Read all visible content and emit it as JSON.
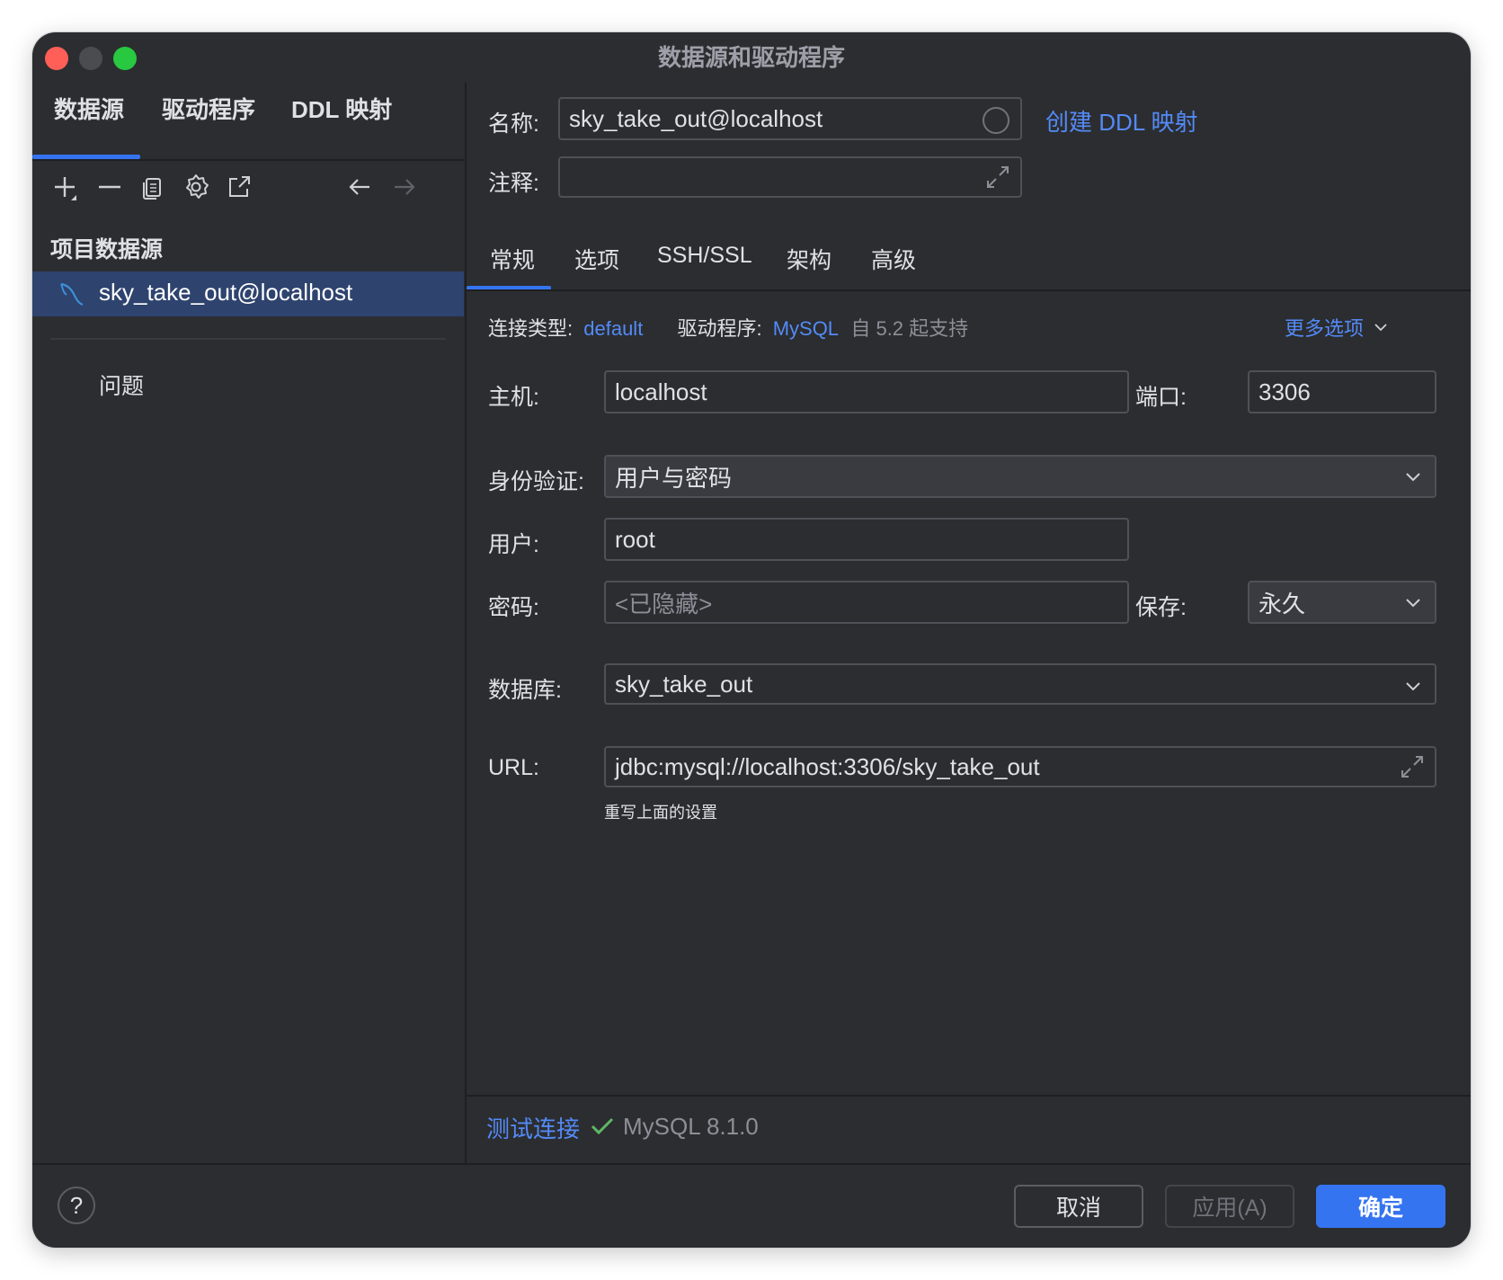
{
  "window": {
    "title": "数据源和驱动程序"
  },
  "sidebar": {
    "tabs": [
      {
        "label": "数据源",
        "active": true
      },
      {
        "label": "驱动程序",
        "active": false
      },
      {
        "label": "DDL 映射",
        "active": false
      }
    ],
    "toolbar": [
      "add-icon",
      "remove-icon",
      "duplicate-icon",
      "settings-icon",
      "open-external-icon",
      "back-arrow-icon",
      "forward-arrow-icon"
    ],
    "section_title": "项目数据源",
    "datasource_item": "sky_take_out@localhost",
    "problems_label": "问题"
  },
  "header": {
    "name_label": "名称:",
    "name_value": "sky_take_out@localhost",
    "create_ddl_link": "创建 DDL 映射",
    "comment_label": "注释:",
    "comment_value": ""
  },
  "tabs": [
    {
      "label": "常规",
      "active": true
    },
    {
      "label": "选项",
      "active": false
    },
    {
      "label": "SSH/SSL",
      "active": false
    },
    {
      "label": "架构",
      "active": false
    },
    {
      "label": "高级",
      "active": false
    }
  ],
  "connection": {
    "type_label": "连接类型:",
    "type_value": "default",
    "driver_label": "驱动程序:",
    "driver_value": "MySQL",
    "driver_note": "自 5.2 起支持",
    "more_options": "更多选项"
  },
  "form": {
    "host_label": "主机:",
    "host_value": "localhost",
    "port_label": "端口:",
    "port_value": "3306",
    "auth_label": "身份验证:",
    "auth_value": "用户与密码",
    "user_label": "用户:",
    "user_value": "root",
    "password_label": "密码:",
    "password_placeholder": "<已隐藏>",
    "save_label": "保存:",
    "save_value": "永久",
    "database_label": "数据库:",
    "database_value": "sky_take_out",
    "url_label": "URL:",
    "url_value": "jdbc:mysql://localhost:3306/sky_take_out",
    "url_hint": "重写上面的设置"
  },
  "test": {
    "link": "测试连接",
    "result": "MySQL 8.1.0",
    "status_color": "#5fb865"
  },
  "footer": {
    "help": "?",
    "cancel": "取消",
    "apply": "应用(A)",
    "ok": "确定",
    "accent_color": "#3574f0"
  }
}
